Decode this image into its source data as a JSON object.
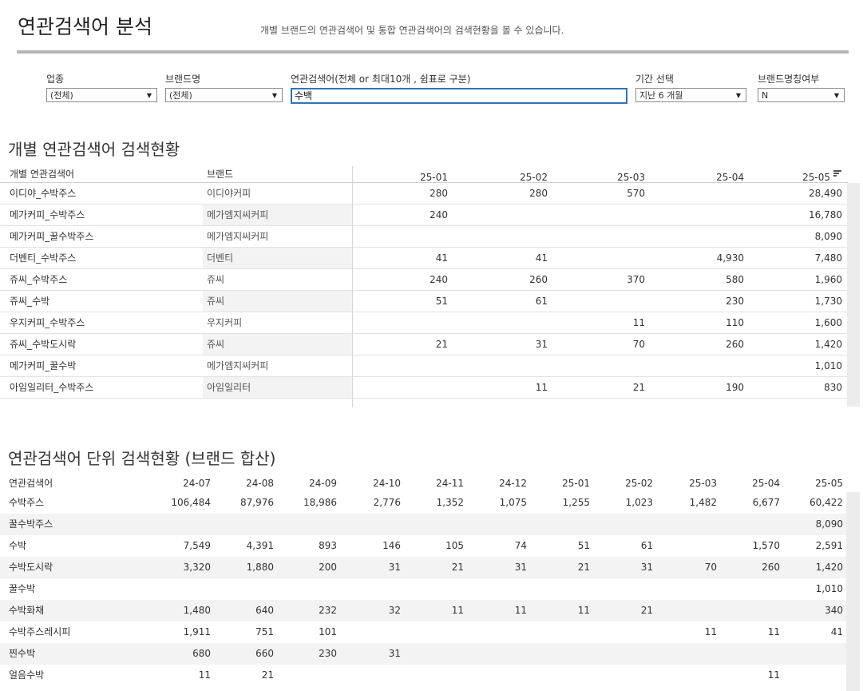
{
  "header": {
    "title": "연관검색어 분석",
    "description": "개별 브랜드의 연관검색어 및 통합 연관검색어의 검색현황을 볼 수 있습니다."
  },
  "filters": [
    {
      "label": "업종",
      "value": "(전체)",
      "type": "select"
    },
    {
      "label": "브랜드명",
      "value": "(전체)",
      "type": "select"
    },
    {
      "label": "연관검색어(전체 or 최대10개 , 쉼표로 구분)",
      "value": "수백",
      "type": "text"
    },
    {
      "label": "기간 선택",
      "value": "지난 6 개월",
      "type": "select"
    },
    {
      "label": "브랜드명칭여부",
      "value": "N",
      "type": "select"
    }
  ],
  "section1": {
    "title": "개별 연관검색어 검색현황",
    "col_keyword": "개별 연관검색어",
    "col_brand": "브랜드",
    "months": [
      "25-01",
      "25-02",
      "25-03",
      "25-04",
      "25-05"
    ],
    "rows": [
      {
        "keyword": "이디야_수박주스",
        "brand": "이디야커피",
        "values": [
          "280",
          "280",
          "570",
          "",
          "28,490"
        ]
      },
      {
        "keyword": "메가커피_수박주스",
        "brand": "메가엠지씨커피",
        "values": [
          "240",
          "",
          "",
          "",
          "16,780"
        ]
      },
      {
        "keyword": "메가커피_꿀수박주스",
        "brand": "메가엠지씨커피",
        "values": [
          "",
          "",
          "",
          "",
          "8,090"
        ]
      },
      {
        "keyword": "더벤티_수박주스",
        "brand": "더벤티",
        "values": [
          "41",
          "41",
          "",
          "4,930",
          "7,480"
        ]
      },
      {
        "keyword": "쥬씨_수박주스",
        "brand": "쥬씨",
        "values": [
          "240",
          "260",
          "370",
          "580",
          "1,960"
        ]
      },
      {
        "keyword": "쥬씨_수박",
        "brand": "쥬씨",
        "values": [
          "51",
          "61",
          "",
          "230",
          "1,730"
        ]
      },
      {
        "keyword": "우지커피_수박주스",
        "brand": "우지커피",
        "values": [
          "",
          "",
          "11",
          "110",
          "1,600"
        ]
      },
      {
        "keyword": "쥬씨_수박도시락",
        "brand": "쥬씨",
        "values": [
          "21",
          "31",
          "70",
          "260",
          "1,420"
        ]
      },
      {
        "keyword": "메가커피_꿀수박",
        "brand": "메가엠지씨커피",
        "values": [
          "",
          "",
          "",
          "",
          "1,010"
        ]
      },
      {
        "keyword": "아임일리터_수박주스",
        "brand": "아임일리터",
        "values": [
          "",
          "11",
          "21",
          "190",
          "830"
        ]
      }
    ]
  },
  "section2": {
    "title": "연관검색어 단위 검색현황 (브랜드 합산)",
    "col_keyword": "연관검색어",
    "months": [
      "24-07",
      "24-08",
      "24-09",
      "24-10",
      "24-11",
      "24-12",
      "25-01",
      "25-02",
      "25-03",
      "25-04",
      "25-05"
    ],
    "rows": [
      {
        "keyword": "수박주스",
        "values": [
          "106,484",
          "87,976",
          "18,986",
          "2,776",
          "1,352",
          "1,075",
          "1,255",
          "1,023",
          "1,482",
          "6,677",
          "60,422"
        ]
      },
      {
        "keyword": "꿀수박주스",
        "values": [
          "",
          "",
          "",
          "",
          "",
          "",
          "",
          "",
          "",
          "",
          "8,090"
        ]
      },
      {
        "keyword": "수박",
        "values": [
          "7,549",
          "4,391",
          "893",
          "146",
          "105",
          "74",
          "51",
          "61",
          "",
          "1,570",
          "2,591"
        ]
      },
      {
        "keyword": "수박도시락",
        "values": [
          "3,320",
          "1,880",
          "200",
          "31",
          "21",
          "31",
          "21",
          "31",
          "70",
          "260",
          "1,420"
        ]
      },
      {
        "keyword": "꿀수박",
        "values": [
          "",
          "",
          "",
          "",
          "",
          "",
          "",
          "",
          "",
          "",
          "1,010"
        ]
      },
      {
        "keyword": "수박화채",
        "values": [
          "1,480",
          "640",
          "232",
          "32",
          "11",
          "11",
          "11",
          "21",
          "",
          "",
          "340"
        ]
      },
      {
        "keyword": "수박주스레시피",
        "values": [
          "1,911",
          "751",
          "101",
          "",
          "",
          "",
          "",
          "",
          "11",
          "11",
          "41"
        ]
      },
      {
        "keyword": "찐수박",
        "values": [
          "680",
          "660",
          "230",
          "31",
          "",
          "",
          "",
          "",
          "",
          "",
          ""
        ]
      },
      {
        "keyword": "얼음수박",
        "values": [
          "11",
          "21",
          "",
          "",
          "",
          "",
          "",
          "",
          "",
          "11",
          ""
        ]
      }
    ]
  },
  "colors": {
    "stripe": "#f3f3f3",
    "focus_border": "#2e75b6",
    "title_rule": "#b5b5b5"
  }
}
